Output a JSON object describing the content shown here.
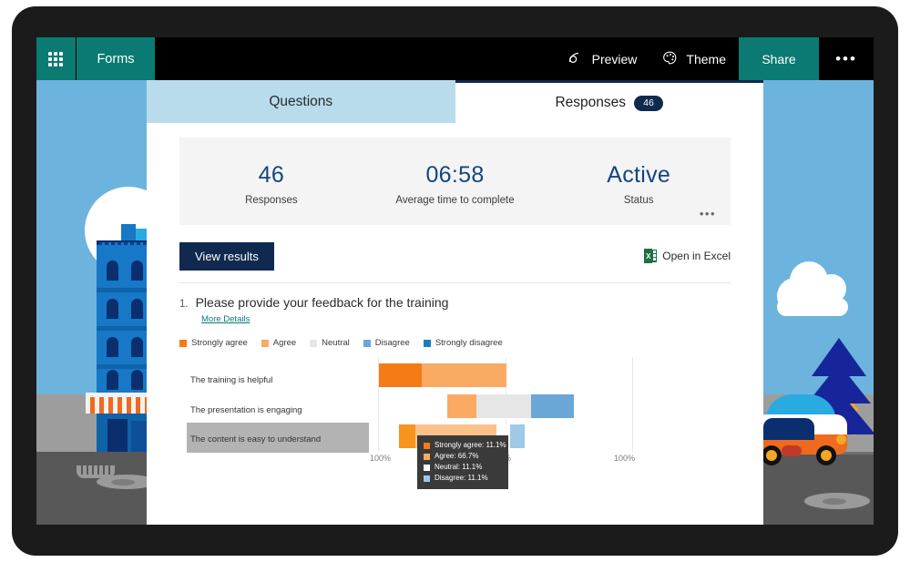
{
  "topbar": {
    "waffle_icon": "app-launcher-waffle-icon",
    "brand": "Forms",
    "preview": {
      "label": "Preview",
      "icon": "eye-preview-icon"
    },
    "theme": {
      "label": "Theme",
      "icon": "palette-theme-icon"
    },
    "share": "Share",
    "more": "•••"
  },
  "tabs": [
    {
      "label": "Questions",
      "active": false
    },
    {
      "label": "Responses",
      "active": true,
      "badge": "46"
    }
  ],
  "stats": {
    "items": [
      {
        "value": "46",
        "caption": "Responses"
      },
      {
        "value": "06:58",
        "caption": "Average time to complete"
      },
      {
        "value": "Active",
        "caption": "Status"
      }
    ],
    "more": "•••"
  },
  "actions": {
    "view_results": "View results",
    "open_in_excel": "Open in Excel",
    "excel_icon": "excel-file-icon"
  },
  "question": {
    "number": "1.",
    "text": "Please provide your feedback for the training",
    "more_details": "More Details"
  },
  "chart_data": {
    "type": "bar",
    "title": "Please provide your feedback for the training",
    "orientation": "horizontal-diverging-stacked",
    "xlabel": "",
    "ylabel": "",
    "xlim": [
      -100,
      100
    ],
    "xticks": [
      "100%",
      "0%",
      "100%"
    ],
    "grid": false,
    "legend_position": "top",
    "categories": [
      "The training is helpful",
      "The presentation is engaging",
      "The content is easy to understand"
    ],
    "series": [
      {
        "name": "Strongly agree",
        "color": "#f47b15",
        "values": [
          33.3,
          0.0,
          11.1
        ]
      },
      {
        "name": "Agree",
        "color": "#fbaa63",
        "values": [
          66.7,
          22.2,
          66.7
        ]
      },
      {
        "name": "Neutral",
        "color": "#e6e6e6",
        "values": [
          0.0,
          44.4,
          11.1
        ]
      },
      {
        "name": "Disagree",
        "color": "#6aa6d6",
        "values": [
          0.0,
          33.3,
          11.1
        ]
      },
      {
        "name": "Strongly disagree",
        "color": "#1b7cc4",
        "values": [
          0.0,
          0.0,
          0.0
        ]
      }
    ],
    "highlighted_category": "The content is easy to understand",
    "tooltip": {
      "rows": [
        {
          "label": "Strongly agree: 11.1%",
          "color": "#f47b15"
        },
        {
          "label": "Agree: 66.7%",
          "color": "#fbaa63"
        },
        {
          "label": "Neutral: 11.1%",
          "color": "#ffffff"
        },
        {
          "label": "Disagree: 11.1%",
          "color": "#9ec9e8"
        }
      ]
    }
  }
}
